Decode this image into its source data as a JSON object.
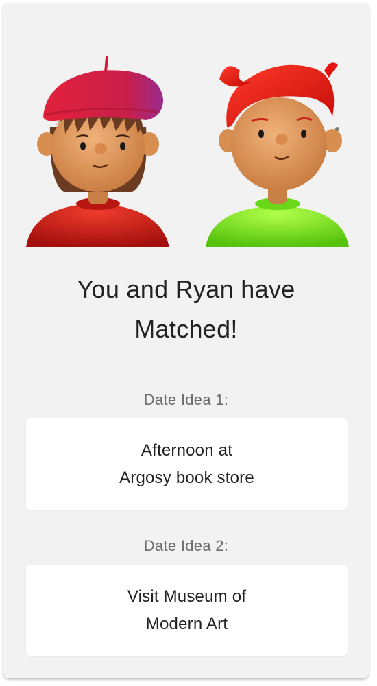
{
  "match": {
    "title_line1": "You and Ryan have",
    "title_line2": "Matched!"
  },
  "avatars": [
    {
      "icon": "avatar-woman-beret-icon",
      "shirt_color": "#d8201e",
      "hair_color": "#6b3c22",
      "hat_color": "#d41a3a"
    },
    {
      "icon": "avatar-man-red-hair-icon",
      "shirt_color": "#7ee81e",
      "hair_color": "#e3140f"
    }
  ],
  "date_ideas": [
    {
      "label": "Date Idea 1:",
      "line1": "Afternoon at",
      "line2": "Argosy book store"
    },
    {
      "label": "Date Idea 2:",
      "line1": "Visit Museum of",
      "line2": "Modern Art"
    }
  ],
  "colors": {
    "card_background": "#f2f2f2",
    "box_background": "#ffffff",
    "text_primary": "#222222",
    "text_secondary": "#6d6d6d"
  }
}
